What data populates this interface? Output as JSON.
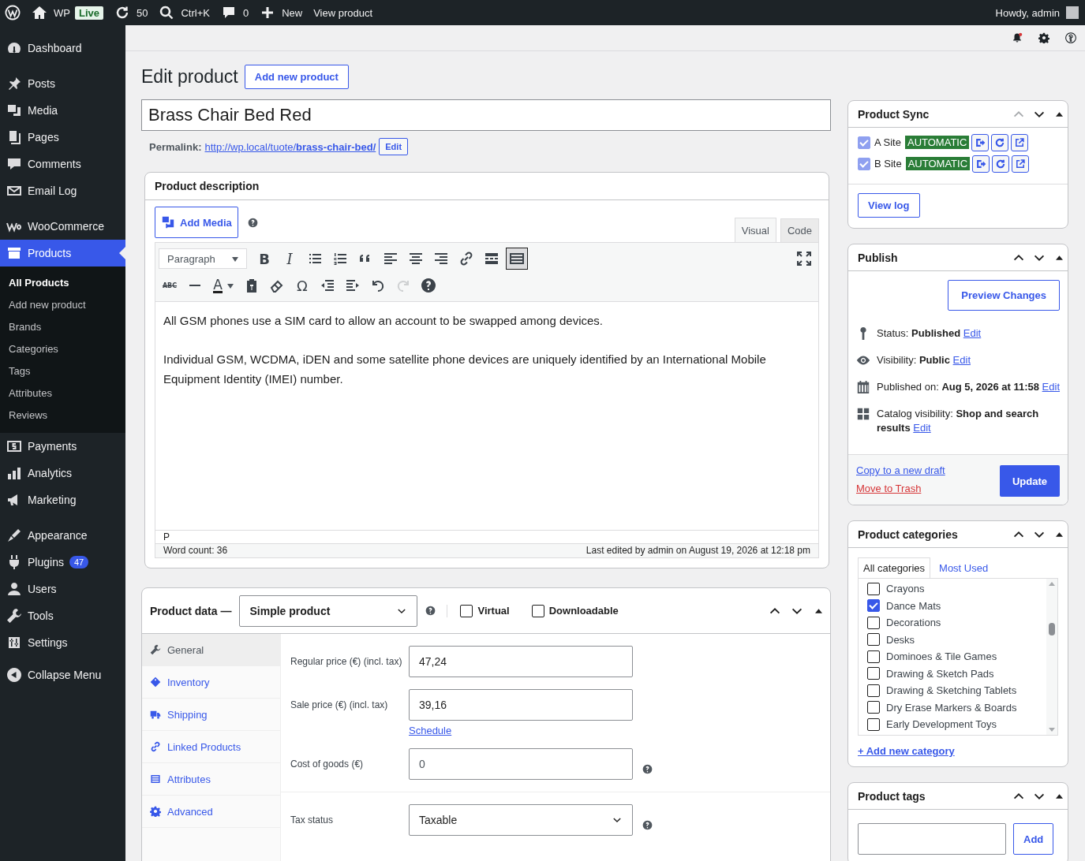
{
  "admin_bar": {
    "items": [
      {
        "kind": "logo"
      },
      {
        "kind": "home",
        "label": "WP"
      },
      {
        "kind": "badge",
        "label": "Live"
      },
      {
        "kind": "updates",
        "label": "50"
      },
      {
        "kind": "search",
        "label": "Ctrl+K"
      },
      {
        "kind": "comments",
        "label": "0"
      },
      {
        "kind": "new",
        "label": "New"
      },
      {
        "kind": "link",
        "label": "View product"
      }
    ],
    "greeting": "Howdy, admin"
  },
  "sidebar": {
    "groups": [
      [
        {
          "label": "Dashboard",
          "selected": false
        }
      ],
      [
        {
          "label": "Posts",
          "selected": false
        },
        {
          "label": "Media",
          "selected": false
        },
        {
          "label": "Pages",
          "selected": false
        },
        {
          "label": "Comments",
          "selected": false
        },
        {
          "label": "Email Log",
          "selected": false
        }
      ],
      [
        {
          "label": "WooCommerce",
          "selected": false
        },
        {
          "label": "Products",
          "selected": true,
          "children": [
            {
              "label": "All Products",
              "selected": true
            },
            {
              "label": "Add new product",
              "selected": false
            },
            {
              "label": "Brands",
              "selected": false
            },
            {
              "label": "Categories",
              "selected": false
            },
            {
              "label": "Tags",
              "selected": false
            },
            {
              "label": "Attributes",
              "selected": false
            },
            {
              "label": "Reviews",
              "selected": false
            }
          ]
        },
        {
          "label": "Payments",
          "selected": false
        },
        {
          "label": "Analytics",
          "selected": false
        },
        {
          "label": "Marketing",
          "selected": false
        }
      ],
      [
        {
          "label": "Appearance",
          "selected": false
        },
        {
          "label": "Plugins",
          "selected": false,
          "badge": "47"
        },
        {
          "label": "Users",
          "selected": false
        },
        {
          "label": "Tools",
          "selected": false
        },
        {
          "label": "Settings",
          "selected": false
        }
      ]
    ],
    "collapse": "Collapse Menu"
  },
  "page": {
    "title": "Edit product",
    "add_new": "Add new product",
    "post_title": "Brass Chair Bed Red",
    "permalink": {
      "label": "Permalink:",
      "url": "http://wp.local/tuote/**brass-chair-bed/**",
      "edit": "Edit"
    }
  },
  "description": {
    "title": "Product description",
    "add_media": "Add Media",
    "tabs": [
      {
        "label": "Visual",
        "selected": true
      },
      {
        "label": "Code",
        "selected": false
      }
    ],
    "toolbar_row_1": [
      {
        "kind": "select",
        "text": "Paragraph",
        "pressed": false,
        "disabled": false
      },
      {
        "kind": "glyph",
        "text": "B",
        "pressed": false,
        "disabled": false
      },
      {
        "kind": "glyph",
        "text": "I",
        "pressed": false,
        "disabled": false
      },
      {
        "kind": "icon",
        "pressed": false,
        "disabled": false
      },
      {
        "kind": "icon",
        "pressed": false,
        "disabled": false
      },
      {
        "kind": "icon",
        "pressed": false,
        "disabled": false
      },
      {
        "kind": "icon",
        "pressed": false,
        "disabled": false
      },
      {
        "kind": "icon",
        "pressed": false,
        "disabled": false
      },
      {
        "kind": "icon",
        "pressed": false,
        "disabled": false
      },
      {
        "kind": "icon",
        "pressed": false,
        "disabled": false
      },
      {
        "kind": "icon",
        "pressed": false,
        "disabled": false
      },
      {
        "kind": "icon",
        "pressed": true,
        "disabled": false
      }
    ],
    "toolbar_row_2": [
      {
        "kind": "glyph",
        "text": "ABC",
        "pressed": false,
        "disabled": false
      },
      {
        "kind": "icon",
        "pressed": false,
        "disabled": false
      },
      {
        "kind": "color",
        "text": "A",
        "pressed": false,
        "disabled": false
      },
      {
        "kind": "icon",
        "pressed": false,
        "disabled": false
      },
      {
        "kind": "icon",
        "pressed": false,
        "disabled": false
      },
      {
        "kind": "glyph",
        "text": "Ω",
        "pressed": false,
        "disabled": false
      },
      {
        "kind": "icon",
        "pressed": false,
        "disabled": false
      },
      {
        "kind": "icon",
        "pressed": false,
        "disabled": false
      },
      {
        "kind": "icon",
        "pressed": false,
        "disabled": false
      },
      {
        "kind": "icon",
        "pressed": false,
        "disabled": true
      },
      {
        "kind": "icon",
        "pressed": false,
        "disabled": false
      }
    ],
    "paragraphs": [
      "All GSM phones use a SIM card to allow an account to be swapped among devices.",
      "Individual GSM, WCDMA, iDEN and some satellite phone devices are uniquely identified by an International Mobile Equipment Identity (IMEI) number."
    ],
    "path": "P",
    "word_count": "Word count: 36",
    "last_edited": "Last edited by admin on August 19, 2026 at 12:18 pm"
  },
  "product_data": {
    "title": "Product data —",
    "type": "Simple product",
    "options": [
      {
        "label": "Virtual",
        "checked": false
      },
      {
        "label": "Downloadable",
        "checked": false
      }
    ],
    "tabs": [
      {
        "label": "General",
        "selected": true
      },
      {
        "label": "Inventory",
        "selected": false
      },
      {
        "label": "Shipping",
        "selected": false
      },
      {
        "label": "Linked Products",
        "selected": false
      },
      {
        "label": "Attributes",
        "selected": false
      },
      {
        "label": "Advanced",
        "selected": false
      }
    ],
    "fields": [
      {
        "kind": "input",
        "label": "Regular price (€) (incl. tax)",
        "value": "47,24"
      },
      {
        "kind": "input",
        "label": "Sale price (€) (incl. tax)",
        "value": "39,16",
        "link": "Schedule"
      },
      {
        "kind": "input",
        "label": "Cost of goods (€)",
        "placeholder": "0",
        "help": true
      },
      {
        "kind": "select",
        "label": "Tax status",
        "value": "Taxable",
        "help": true
      }
    ]
  },
  "product_sync": {
    "title": "Product Sync",
    "sites": [
      {
        "label": "A Site",
        "checked": true,
        "mode": "AUTOMATIC"
      },
      {
        "label": "B Site",
        "checked": true,
        "mode": "AUTOMATIC"
      }
    ],
    "view_log": "View log"
  },
  "publish": {
    "title": "Publish",
    "preview": "Preview Changes",
    "rows": [
      {
        "kind": "status",
        "text": "Status: **Published**",
        "link": "Edit"
      },
      {
        "kind": "visibility",
        "text": "Visibility: **Public**",
        "link": "Edit"
      },
      {
        "kind": "date",
        "text": "Published on: **Aug 5, 2026 at 11:58**",
        "link": "Edit"
      },
      {
        "kind": "catalog",
        "text": "Catalog visibility: **Shop and search results**",
        "link": "Edit"
      }
    ],
    "copy": "Copy to a new draft",
    "trash": "Move to Trash",
    "update": "Update"
  },
  "categories": {
    "title": "Product categories",
    "tabs": [
      {
        "label": "All categories",
        "selected": true
      },
      {
        "label": "Most Used",
        "selected": false
      }
    ],
    "items": [
      {
        "label": "Crayons",
        "checked": false
      },
      {
        "label": "Dance Mats",
        "checked": true
      },
      {
        "label": "Decorations",
        "checked": false
      },
      {
        "label": "Desks",
        "checked": false
      },
      {
        "label": "Dominoes & Tile Games",
        "checked": false
      },
      {
        "label": "Drawing & Sketch Pads",
        "checked": false
      },
      {
        "label": "Drawing & Sketching Tablets",
        "checked": false
      },
      {
        "label": "Dry Erase Markers & Boards",
        "checked": false
      },
      {
        "label": "Early Development Toys",
        "checked": false
      }
    ],
    "add_new": "+ Add new category"
  },
  "tags": {
    "title": "Product tags",
    "add": "Add"
  }
}
